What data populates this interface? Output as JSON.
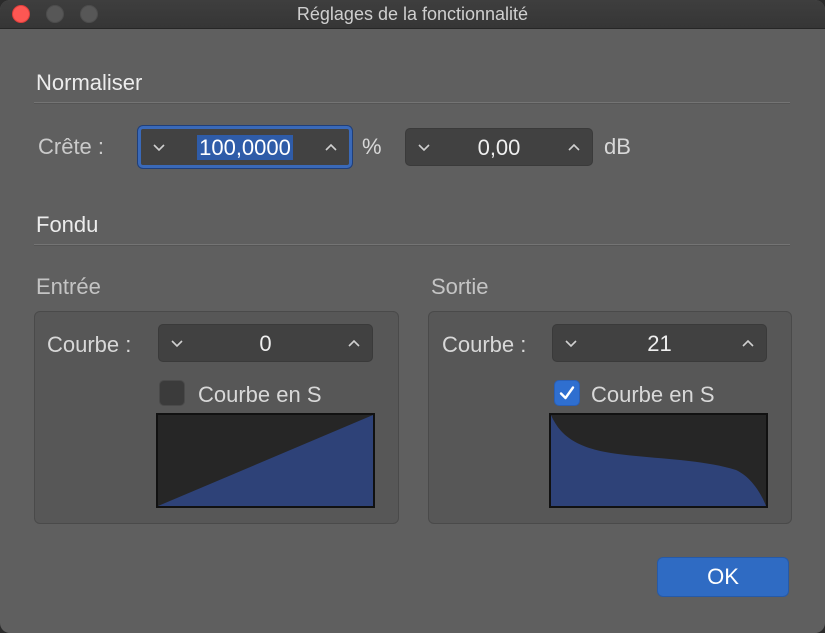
{
  "window": {
    "title": "Réglages de la fonctionnalité"
  },
  "normaliser": {
    "heading": "Normaliser",
    "peak_label": "Crête :",
    "percent_value": "100,0000",
    "percent_unit": "%",
    "db_value": "0,00",
    "db_unit": "dB"
  },
  "fondu": {
    "heading": "Fondu",
    "entree": {
      "title": "Entrée",
      "curve_label": "Courbe :",
      "curve_value": "0",
      "scurve_label": "Courbe en S",
      "scurve_checked": false
    },
    "sortie": {
      "title": "Sortie",
      "curve_label": "Courbe :",
      "curve_value": "21",
      "scurve_label": "Courbe en S",
      "scurve_checked": true
    }
  },
  "footer": {
    "ok_label": "OK"
  },
  "colors": {
    "accent": "#2f6bc3",
    "curve_fill": "#2e4278",
    "close_button": "#fc5753"
  },
  "icons": {
    "decrement": "chevron-down-icon",
    "increment": "chevron-up-icon",
    "check": "checkmark-icon"
  }
}
